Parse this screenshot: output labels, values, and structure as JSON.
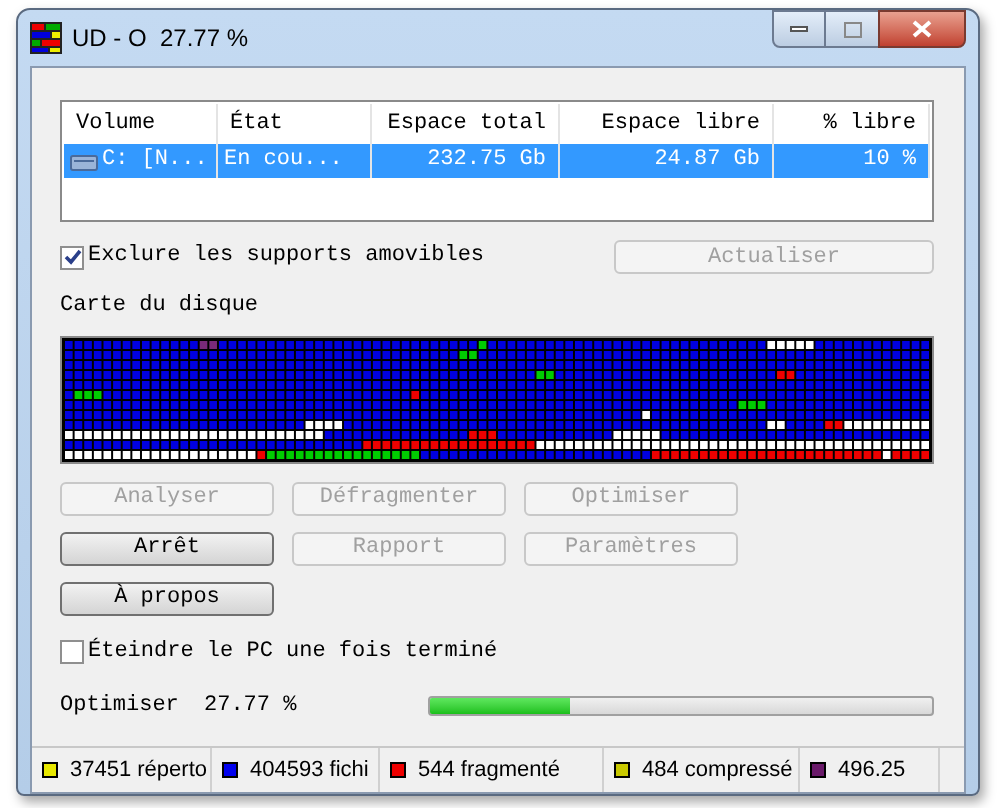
{
  "window": {
    "title": "UD - O  27.77 %"
  },
  "volumes": {
    "columns": [
      "Volume",
      "État",
      "Espace total",
      "Espace libre",
      "% libre"
    ],
    "rows": [
      {
        "selected": true,
        "cells": [
          "C: [N...",
          "En cou...",
          "232.75 Gb",
          "24.87 Gb",
          "10 %"
        ]
      }
    ]
  },
  "exclude_removable": {
    "label": "Exclure les supports amovibles",
    "checked": true
  },
  "refresh_button": {
    "label": "Actualiser",
    "disabled": true
  },
  "disk_map": {
    "label": "Carte du disque"
  },
  "buttons": [
    {
      "label": "Analyser",
      "disabled": true
    },
    {
      "label": "Défragmenter",
      "disabled": true
    },
    {
      "label": "Optimiser",
      "disabled": true
    },
    {
      "label": "Arrêt",
      "disabled": false
    },
    {
      "label": "Rapport",
      "disabled": true
    },
    {
      "label": "Paramètres",
      "disabled": true
    },
    {
      "label": "À propos",
      "disabled": false
    }
  ],
  "shutdown": {
    "label": "Éteindre le PC une fois terminé",
    "checked": false
  },
  "progress": {
    "label": "Optimiser",
    "reading": "27.77 %",
    "level": 0.2778
  },
  "status_bar": [
    {
      "text": "37451 réperto",
      "color": "#e8e800"
    },
    {
      "text": "404593 fichi",
      "color": "#0000ee"
    },
    {
      "text": "544 fragmenté",
      "color": "#ee0000"
    },
    {
      "text": "484 compressé",
      "color": "#c8c800"
    },
    {
      "text": "496.25",
      "color": "#6a1a6a"
    }
  ]
}
